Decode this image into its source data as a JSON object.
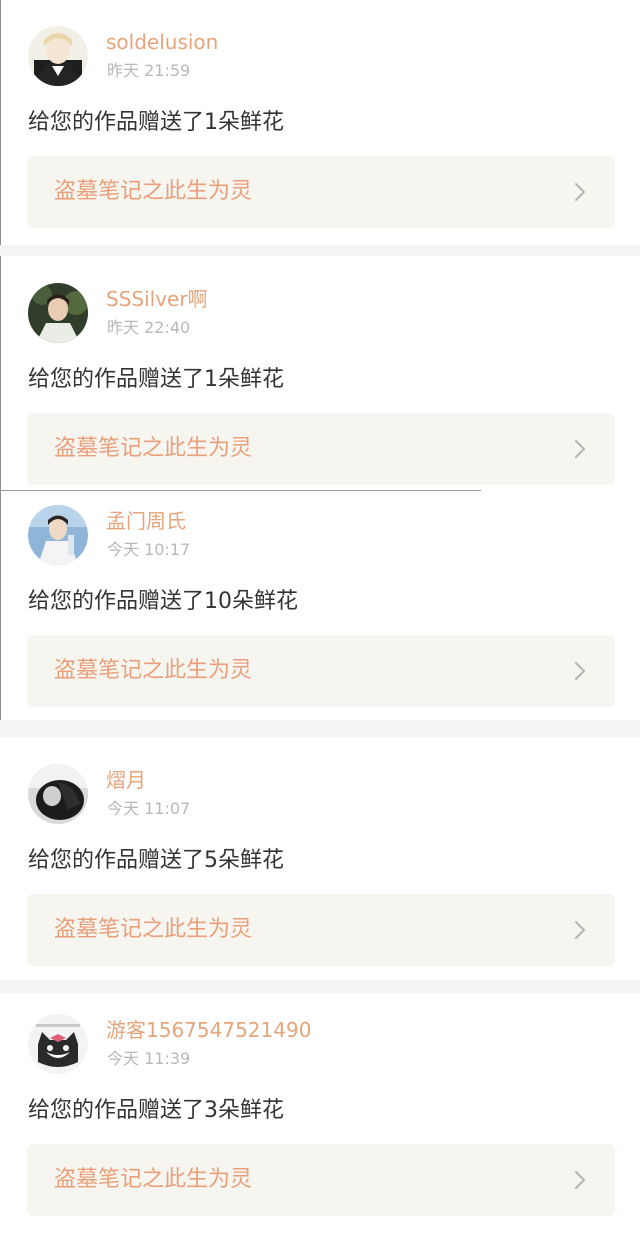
{
  "entries": [
    {
      "username": "soldelusion",
      "time": "昨天 21:59",
      "message": "给您的作品赠送了1朵鲜花",
      "work_title": "盗墓笔记之此生为灵"
    },
    {
      "username": "SSSilver啊",
      "time": "昨天 22:40",
      "message": "给您的作品赠送了1朵鲜花",
      "work_title": "盗墓笔记之此生为灵"
    },
    {
      "username": "孟门周氏",
      "time": "今天 10:17",
      "message": "给您的作品赠送了10朵鲜花",
      "work_title": "盗墓笔记之此生为灵"
    },
    {
      "username": "熠月",
      "time": "今天 11:07",
      "message": "给您的作品赠送了5朵鲜花",
      "work_title": "盗墓笔记之此生为灵"
    },
    {
      "username": "游客1567547521490",
      "time": "今天 11:39",
      "message": "给您的作品赠送了3朵鲜花",
      "work_title": "盗墓笔记之此生为灵"
    }
  ],
  "icons": {
    "card_arrow": "chevron-right-icon"
  },
  "colors": {
    "username": "#e6a47a",
    "work_title": "#e9a07a",
    "time": "#b8b8b8",
    "message": "#333333",
    "card_background": "#f6f5f0",
    "separator": "#f4f4f4"
  }
}
